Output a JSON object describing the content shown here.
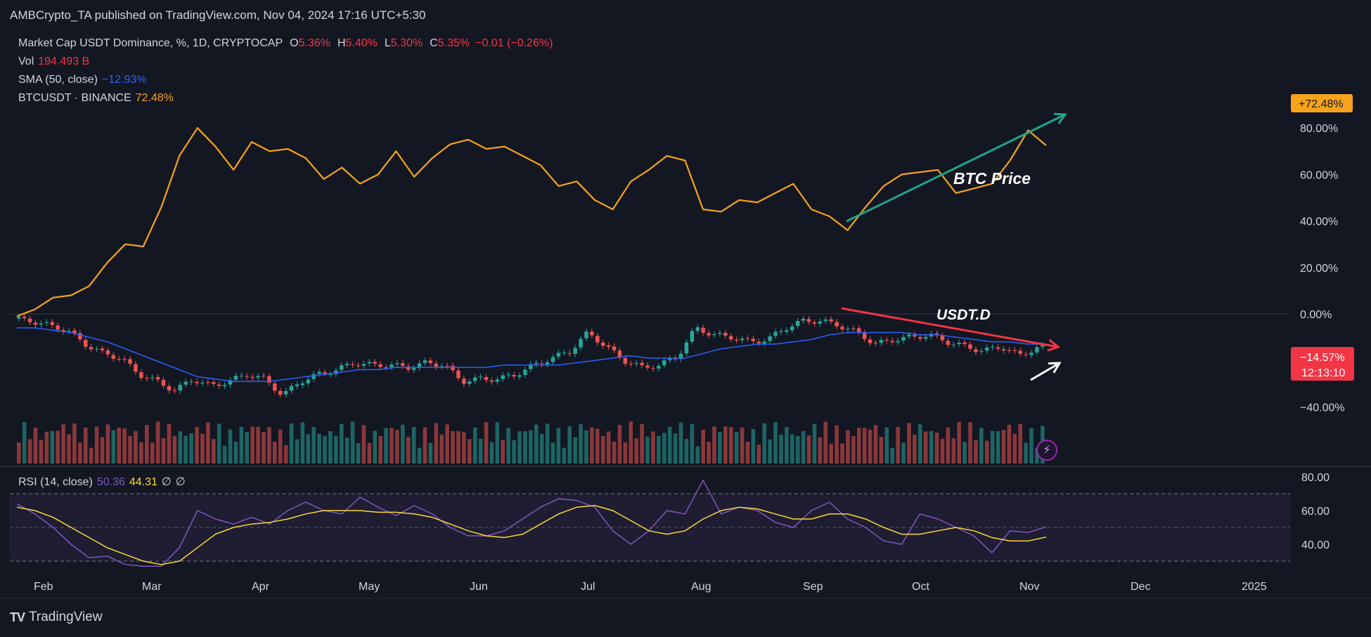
{
  "header": {
    "published": "AMBCrypto_TA published on TradingView.com, Nov 04, 2024 17:16 UTC+5:30"
  },
  "legend": {
    "symbol": "Market Cap USDT Dominance, %, 1D, CRYPTOCAP",
    "o_label": "O",
    "o": "5.36%",
    "h_label": "H",
    "h": "5.40%",
    "l_label": "L",
    "l": "5.30%",
    "c_label": "C",
    "c": "5.35%",
    "change": "−0.01 (−0.26%)",
    "vol_label": "Vol",
    "vol": "194.493 B",
    "sma_label": "SMA (50, close)",
    "sma": "−12.93%",
    "btc_label": "BTCUSDT · BINANCE",
    "btc": "72.48%",
    "rsi_label": "RSI (14, close)",
    "rsi": "50.36",
    "rsi_ma": "44.31",
    "rsi_x1": "∅",
    "rsi_x2": "∅"
  },
  "annotations": {
    "btc_price": "BTC Price",
    "usdt_d": "USDT.D"
  },
  "price_axis": {
    "ticks": [
      "80.00%",
      "60.00%",
      "40.00%",
      "20.00%",
      "0.00%",
      "−40.00%"
    ],
    "btc_badge": "+72.48%",
    "usdt_badge": "−14.57%",
    "countdown": "12:13:10"
  },
  "rsi_axis": {
    "ticks": [
      "80.00",
      "60.00",
      "40.00"
    ]
  },
  "time_axis": {
    "labels": [
      "Feb",
      "Mar",
      "Apr",
      "May",
      "Jun",
      "Jul",
      "Aug",
      "Sep",
      "Oct",
      "Nov",
      "Dec",
      "2025"
    ]
  },
  "footer": {
    "brand": "TradingView"
  },
  "colors": {
    "background": "#131722",
    "btc": "#f7a21b",
    "sma": "#2962ff",
    "up": "#26a69a",
    "down": "#ef5350",
    "rsi": "#7e57c2",
    "rsi_ma": "#fdd835",
    "trend_up": "#1fa38a",
    "trend_down": "#f23645",
    "arrow_white": "#ffffff"
  },
  "chart_data": {
    "type": "line",
    "title": "Market Cap USDT Dominance, %, 1D, CRYPTOCAP",
    "x": [
      "Jan 24",
      "Jan 29",
      "Feb 03",
      "Feb 08",
      "Feb 13",
      "Feb 18",
      "Feb 23",
      "Feb 28",
      "Mar 04",
      "Mar 09",
      "Mar 14",
      "Mar 19",
      "Mar 24",
      "Mar 29",
      "Apr 03",
      "Apr 08",
      "Apr 13",
      "Apr 18",
      "Apr 23",
      "Apr 28",
      "May 03",
      "May 08",
      "May 13",
      "May 18",
      "May 23",
      "May 28",
      "Jun 02",
      "Jun 07",
      "Jun 12",
      "Jun 17",
      "Jun 22",
      "Jun 27",
      "Jul 02",
      "Jul 07",
      "Jul 12",
      "Jul 17",
      "Jul 22",
      "Jul 27",
      "Aug 01",
      "Aug 06",
      "Aug 11",
      "Aug 16",
      "Aug 21",
      "Aug 26",
      "Aug 31",
      "Sep 05",
      "Sep 10",
      "Sep 15",
      "Sep 20",
      "Sep 25",
      "Sep 30",
      "Oct 05",
      "Oct 10",
      "Oct 15",
      "Oct 20",
      "Oct 25",
      "Oct 30",
      "Nov 04"
    ],
    "series": [
      {
        "name": "BTCUSDT · BINANCE",
        "values": [
          -1,
          2,
          7,
          8,
          12,
          22,
          30,
          29,
          46,
          68,
          80,
          72,
          62,
          74,
          70,
          71,
          67,
          58,
          63,
          56,
          60,
          70,
          59,
          67,
          73,
          75,
          71,
          72,
          68,
          64,
          55,
          57,
          49,
          45,
          57,
          62,
          68,
          66,
          45,
          44,
          49,
          48,
          52,
          56,
          45,
          42,
          36,
          46,
          55,
          60,
          61,
          62,
          52,
          54,
          56,
          66,
          79,
          72.48
        ]
      },
      {
        "name": "Market Cap USDT Dominance",
        "values": [
          -2,
          -3,
          -5,
          -7,
          -13,
          -17,
          -19,
          -26,
          -29,
          -33,
          -28,
          -31,
          -29,
          -26,
          -28,
          -35,
          -29,
          -26,
          -24,
          -21,
          -22,
          -22,
          -23,
          -21,
          -22,
          -29,
          -28,
          -28,
          -26,
          -22,
          -19,
          -16,
          -8,
          -14,
          -20,
          -23,
          -22,
          -18,
          -6,
          -9,
          -10,
          -12,
          -11,
          -6,
          -3,
          -3,
          -5,
          -8,
          -13,
          -11,
          -10,
          -9,
          -12,
          -14,
          -16,
          -14,
          -18,
          -14.57
        ]
      },
      {
        "name": "SMA (50, close)",
        "values": [
          -6,
          -6,
          -7,
          -8,
          -10,
          -12,
          -15,
          -18,
          -21,
          -24,
          -27,
          -28,
          -29,
          -29,
          -29,
          -28,
          -27,
          -26,
          -25,
          -24,
          -24,
          -23,
          -23,
          -23,
          -23,
          -23,
          -23,
          -22,
          -22,
          -22,
          -22,
          -21,
          -20,
          -19,
          -18,
          -19,
          -19,
          -19,
          -17,
          -15,
          -14,
          -13,
          -13,
          -12,
          -11,
          -9,
          -8,
          -8,
          -8,
          -8,
          -9,
          -9,
          -10,
          -11,
          -12,
          -12,
          -13,
          -12.93
        ]
      },
      {
        "name": "RSI (14, close)",
        "values": [
          64,
          58,
          50,
          40,
          32,
          33,
          28,
          27,
          27,
          38,
          60,
          55,
          52,
          56,
          52,
          60,
          65,
          60,
          58,
          68,
          62,
          57,
          63,
          58,
          50,
          45,
          45,
          48,
          55,
          62,
          67,
          66,
          62,
          48,
          40,
          48,
          60,
          58,
          78,
          58,
          62,
          60,
          53,
          50,
          60,
          65,
          55,
          50,
          42,
          40,
          58,
          55,
          50,
          45,
          35,
          48,
          47,
          50.36
        ]
      },
      {
        "name": "RSI MA",
        "values": [
          62,
          60,
          56,
          50,
          44,
          38,
          34,
          30,
          28,
          30,
          38,
          46,
          50,
          52,
          53,
          55,
          58,
          60,
          60,
          60,
          59,
          59,
          58,
          56,
          52,
          48,
          45,
          44,
          46,
          52,
          58,
          62,
          63,
          60,
          54,
          48,
          46,
          48,
          55,
          60,
          62,
          61,
          58,
          55,
          55,
          58,
          58,
          55,
          50,
          46,
          46,
          48,
          50,
          48,
          44,
          42,
          42,
          44.31
        ]
      }
    ],
    "ylim": [
      -50,
      90
    ],
    "rsi_ylim": [
      20,
      85
    ]
  }
}
